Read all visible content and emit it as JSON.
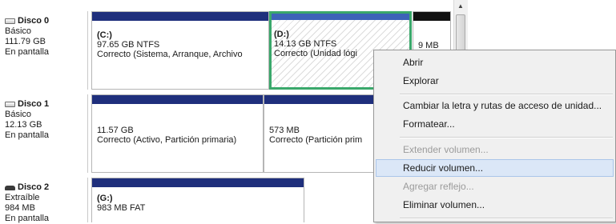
{
  "disks": [
    {
      "name": "Disco 0",
      "type": "Básico",
      "size": "111.79 GB",
      "status": "En pantalla",
      "icon": "hard-disk-icon"
    },
    {
      "name": "Disco 1",
      "type": "Básico",
      "size": "12.13 GB",
      "status": "En pantalla",
      "icon": "hard-disk-icon"
    },
    {
      "name": "Disco 2",
      "type": "Extraíble",
      "size": "984 MB",
      "status": "En pantalla",
      "icon": "removable-disk-icon"
    }
  ],
  "partitions": {
    "d0_c": {
      "label": "(C:)",
      "size": "97.65 GB NTFS",
      "status": "Correcto (Sistema, Arranque, Archivo"
    },
    "d0_d": {
      "label": "(D:)",
      "size": "14.13 GB NTFS",
      "status": "Correcto (Unidad lógi"
    },
    "d0_unalloc": {
      "size": "9 MB"
    },
    "d1_p1": {
      "size": "11.57 GB",
      "status": "Correcto (Activo, Partición primaria)"
    },
    "d1_p2": {
      "size": "573 MB",
      "status": "Correcto (Partición prim"
    },
    "d2_g": {
      "label": "(G:)",
      "size": "983 MB FAT"
    }
  },
  "context_menu": {
    "items": [
      {
        "label": "Abrir",
        "enabled": true
      },
      {
        "label": "Explorar",
        "enabled": true
      },
      {
        "label": "Cambiar la letra y rutas de acceso de unidad...",
        "enabled": true
      },
      {
        "label": "Formatear...",
        "enabled": true
      },
      {
        "label": "Extender volumen...",
        "enabled": false
      },
      {
        "label": "Reducir volumen...",
        "enabled": true,
        "highlighted": true
      },
      {
        "label": "Agregar reflejo...",
        "enabled": false
      },
      {
        "label": "Eliminar volumen...",
        "enabled": true
      }
    ]
  },
  "colors": {
    "primary_bar": "#1f2f7c",
    "selection_border": "#3aa86b",
    "menu_highlight": "#dbe7f7"
  }
}
